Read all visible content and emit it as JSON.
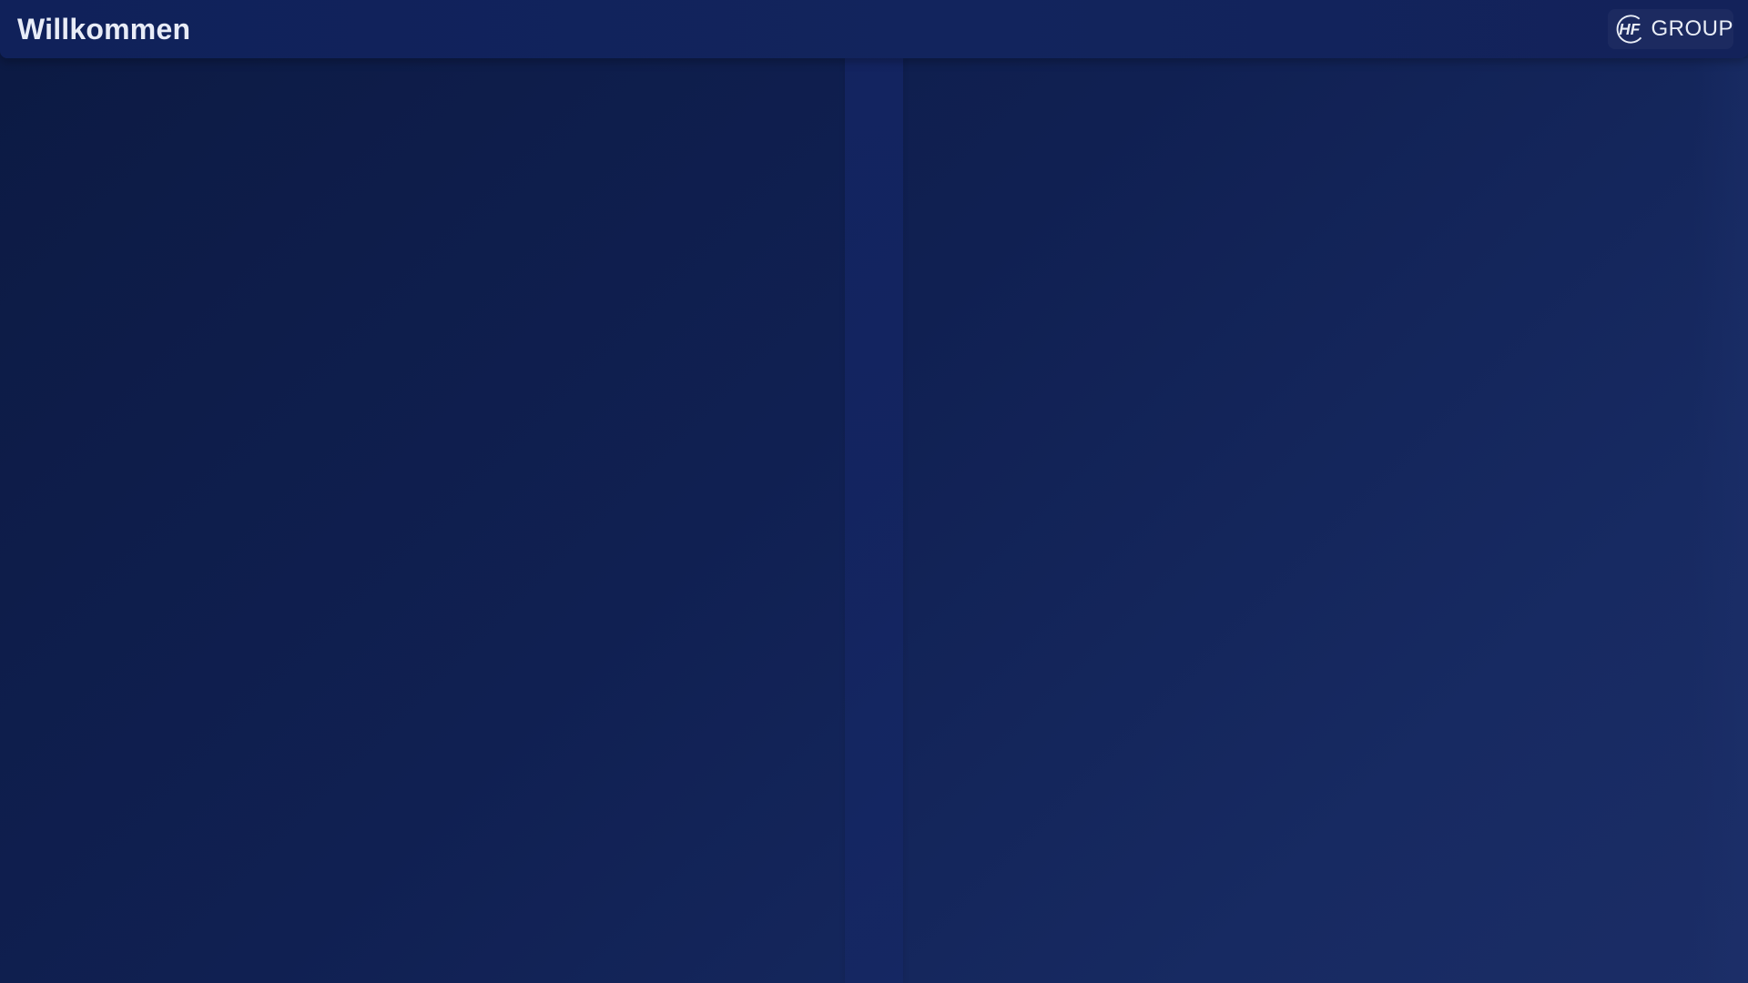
{
  "header": {
    "title": "Willkommen",
    "logo": {
      "icon": "hf-logo-icon",
      "icon_text": "HF",
      "text": "GROUP"
    }
  },
  "colors": {
    "background_dark": "#0c1a43",
    "background_light": "#1b2d66",
    "header": "#12245d",
    "title_text": "#e8ecf7"
  }
}
